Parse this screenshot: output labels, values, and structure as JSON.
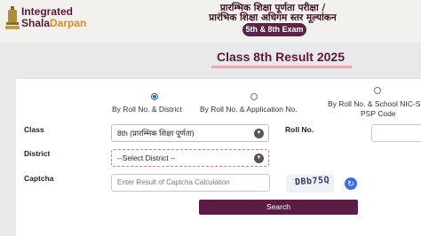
{
  "header": {
    "logo_line1": "Integrated",
    "logo_line2_a": "Shala",
    "logo_line2_b": "Darpan",
    "hindi_title_line1": "प्रारम्भिक शिक्षा पूर्णता परीक्षा /",
    "hindi_title_line2": "प्रारंभिक शिक्षा अधिगम स्तर मूल्यांकन",
    "exam_badge": "5th & 8th Exam"
  },
  "page_title": "Class 8th Result 2025",
  "search_options": [
    {
      "label": "By Roll No. & District",
      "selected": true
    },
    {
      "label": "By Roll No. & Application No.",
      "selected": false
    },
    {
      "label_line1": "By Roll No. & School NIC-SD C",
      "label_line2": "PSP Code",
      "selected": false
    }
  ],
  "form": {
    "class_label": "Class",
    "class_value": "8th (प्रारम्भिक शिक्षा पूर्णता)",
    "roll_label": "Roll No.",
    "district_label": "District",
    "district_value": "--Select District --",
    "captcha_label": "Captcha",
    "captcha_placeholder": "Enter Result of Captcha Calculation",
    "captcha_text": "DBb75Q",
    "search_button": "Search"
  },
  "icons": {
    "dropdown": "chevron-down-icon",
    "refresh": "refresh-icon",
    "emblem": "state-emblem-icon"
  },
  "colors": {
    "brand": "#5a1a36",
    "button": "#5a1e44",
    "accent": "#e48a1e",
    "radio_selected": "#2d68c4"
  }
}
